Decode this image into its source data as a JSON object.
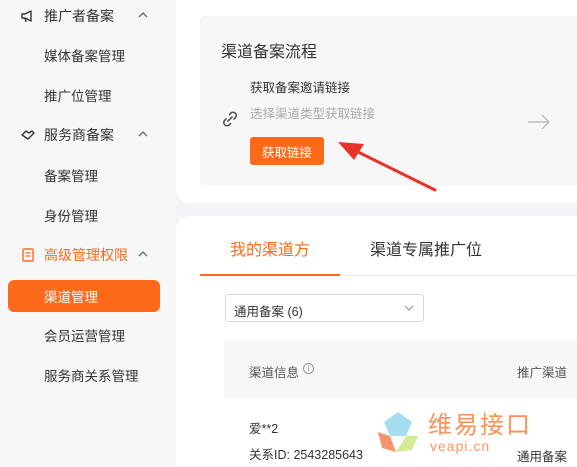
{
  "sidebar": {
    "groups": [
      {
        "label": "推广者备案",
        "icon": "megaphone-icon"
      },
      {
        "label": "服务商备案",
        "icon": "handshake-icon"
      },
      {
        "label": "高级管理权限",
        "icon": "document-icon"
      }
    ],
    "items": [
      {
        "label": "媒体备案管理"
      },
      {
        "label": "推广位管理"
      },
      {
        "label": "备案管理"
      },
      {
        "label": "身份管理"
      },
      {
        "label": "渠道管理"
      },
      {
        "label": "会员运营管理"
      },
      {
        "label": "服务商关系管理"
      }
    ]
  },
  "flow": {
    "title": "渠道备案流程",
    "step_title": "获取备案邀请链接",
    "step_desc": "选择渠道类型获取链接",
    "button_label": "获取链接"
  },
  "tabs": [
    {
      "label": "我的渠道方"
    },
    {
      "label": "渠道专属推广位"
    }
  ],
  "filter": {
    "selected": "通用备案 (6)"
  },
  "table": {
    "headers": [
      "渠道信息",
      "推广渠道"
    ],
    "info_icon": "i",
    "rows": [
      {
        "name": "爱**2",
        "id": "关系ID: 2543285643",
        "channel": "通用备案"
      }
    ]
  },
  "watermark": {
    "text": "维易接口",
    "url": "veapi.cn"
  },
  "colors": {
    "accent": "#ff6a1a",
    "annotation": "#e8332a"
  }
}
